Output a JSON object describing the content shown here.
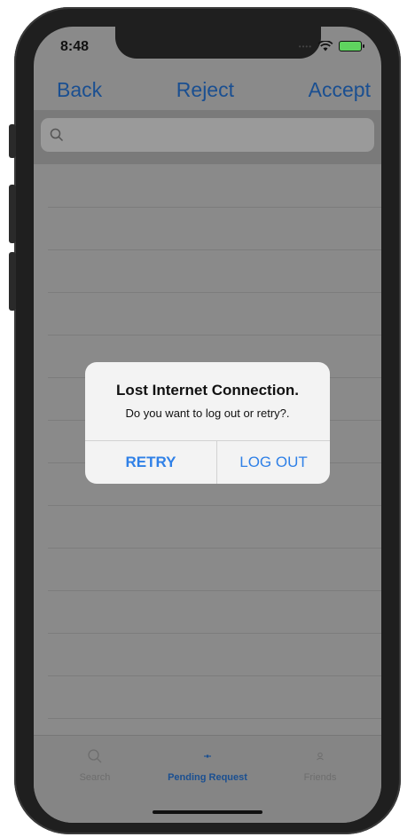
{
  "status": {
    "time": "8:48"
  },
  "nav": {
    "back": "Back",
    "reject": "Reject",
    "accept": "Accept"
  },
  "search": {
    "placeholder": ""
  },
  "tabs": [
    {
      "label": "Search",
      "icon": "search-icon",
      "active": false
    },
    {
      "label": "Pending Request",
      "icon": "pending-icon",
      "active": true
    },
    {
      "label": "Friends",
      "icon": "friends-icon",
      "active": false
    }
  ],
  "alert": {
    "title": "Lost Internet Connection.",
    "message": "Do you want to log out or retry?.",
    "retry": "RETRY",
    "logout": "LOG OUT"
  },
  "colors": {
    "accent": "#2f80e7",
    "dimmed_accent": "#1a4f91"
  }
}
